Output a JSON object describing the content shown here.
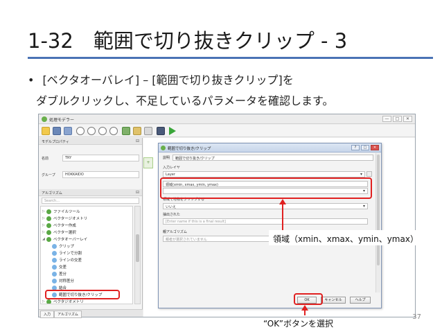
{
  "slide": {
    "title": "1-32　範囲で切り抜きクリップ - 3",
    "bullet_symbol": "•",
    "bullet_line1": "[ベクタオーバレイ] – [範囲で切り抜きクリップ]を",
    "bullet_line2": "ダブルクリックし、不足しているパラメータを確認します。",
    "page_number": "37",
    "accent_color": "#4a73b5",
    "highlight_color": "#e02020"
  },
  "annotations": {
    "extent_note": "領域（xmin、xmax、ymin、ymax）",
    "ok_note": "“OK”ボタンを選択"
  },
  "modeler": {
    "window_title": "処理モデラー",
    "win_buttons": [
      "—",
      "□",
      "✕"
    ],
    "properties_header": "モデルプロパティ",
    "name_label": "名前",
    "name_value": "TRY",
    "group_label": "グループ",
    "group_value": "HOKKAIDO",
    "algorithms_header": "アルゴリズム",
    "search_placeholder": "Search...",
    "tree": [
      {
        "label": "ファイルツール",
        "arrow": "▷",
        "level": 0
      },
      {
        "label": "ベクタージオメトリ",
        "arrow": "▷",
        "level": 0
      },
      {
        "label": "ベクター作成",
        "arrow": "▷",
        "level": 0
      },
      {
        "label": "ベクター選択",
        "arrow": "▷",
        "level": 0
      },
      {
        "label": "ベクタオーバーレイ",
        "arrow": "◢",
        "level": 0
      },
      {
        "label": "クリップ",
        "arrow": "",
        "level": 1
      },
      {
        "label": "ラインで分割",
        "arrow": "",
        "level": 1
      },
      {
        "label": "ラインの交差",
        "arrow": "",
        "level": 1
      },
      {
        "label": "交差",
        "arrow": "",
        "level": 1
      },
      {
        "label": "差分",
        "arrow": "",
        "level": 1
      },
      {
        "label": "対称差分",
        "arrow": "",
        "level": 1
      },
      {
        "label": "結合",
        "arrow": "",
        "level": 1
      },
      {
        "label": "範囲で切り抜き/クリップ",
        "arrow": "",
        "level": 1
      },
      {
        "label": "ベクタジオメトリ",
        "arrow": "▷",
        "level": 0
      }
    ],
    "tab_inputs": "入力",
    "tab_algorithms": "アルゴリズム"
  },
  "dialog": {
    "title": "範囲で切り抜き/クリップ",
    "win_buttons": [
      "?",
      "□",
      "✕"
    ],
    "description_label": "説明",
    "description_value": "範囲で切り抜き/クリップ",
    "input_layer_label": "入力レイヤ",
    "input_layer_value": "Layer",
    "extent_label": "領域(xmin, xmax, ymin, ymax)",
    "extent_value": "",
    "clip_to_extent_label": "領域で地物をクリップする",
    "clip_to_extent_value": "いいえ",
    "output_label": "抽出された",
    "output_placeholder": "[Enter name if this is a final result]",
    "depends_label": "親アルゴリズム",
    "depends_value": "親者が選択されていません",
    "ok_button": "OK",
    "cancel_button": "キャンセル",
    "help_button": "ヘルプ"
  }
}
